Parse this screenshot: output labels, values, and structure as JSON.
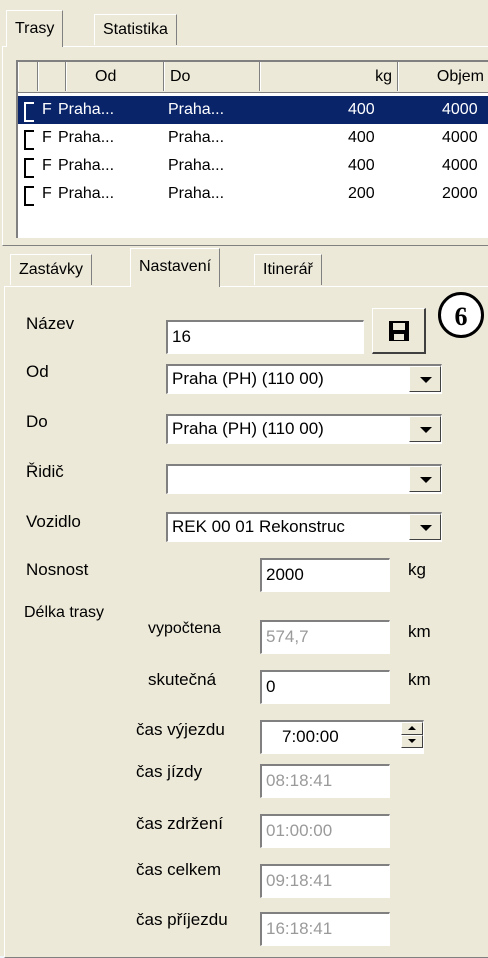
{
  "top_tabs": [
    "Trasy",
    "Statistika"
  ],
  "grid": {
    "columns": [
      "",
      "Od",
      "Do",
      "kg",
      "Objem"
    ],
    "rows": [
      {
        "flag": "F",
        "od": "Praha...",
        "do": "Praha...",
        "kg": "400",
        "objem": "4000",
        "selected": true
      },
      {
        "flag": "F",
        "od": "Praha...",
        "do": "Praha...",
        "kg": "400",
        "objem": "4000",
        "selected": false
      },
      {
        "flag": "F",
        "od": "Praha...",
        "do": "Praha...",
        "kg": "400",
        "objem": "4000",
        "selected": false
      },
      {
        "flag": "F",
        "od": "Praha...",
        "do": "Praha...",
        "kg": "200",
        "objem": "2000",
        "selected": false
      }
    ]
  },
  "sub_tabs": [
    "Zastávky",
    "Nastavení",
    "Itinerář"
  ],
  "form": {
    "nazev_label": "Název",
    "nazev_value": "16",
    "od_label": "Od",
    "od_value": "Praha  (PH) (110 00)",
    "do_label": "Do",
    "do_value": "Praha  (PH) (110 00)",
    "ridic_label": "Řidič",
    "ridic_value": "",
    "vozidlo_label": "Vozidlo",
    "vozidlo_value": "REK 00 01 Rekonstruc",
    "nosnost_label": "Nosnost",
    "nosnost_value": "2000",
    "nosnost_unit": "kg",
    "delka_label": "Délka trasy",
    "vypoctena_label": "vypočtena",
    "vypoctena_value": "574,7",
    "vypoctena_unit": "km",
    "skutecna_label": "skutečná",
    "skutecna_value": "0",
    "skutecna_unit": "km",
    "cas_vyjezdu_label": "čas výjezdu",
    "cas_vyjezdu_value": "7:00:00",
    "cas_jizdy_label": "čas jízdy",
    "cas_jizdy_value": "08:18:41",
    "cas_zdrzeni_label": "čas zdržení",
    "cas_zdrzeni_value": "01:00:00",
    "cas_celkem_label": "čas celkem",
    "cas_celkem_value": "09:18:41",
    "cas_prijezdu_label": "čas příjezdu",
    "cas_prijezdu_value": "16:18:41"
  },
  "callout_number": "6",
  "colors": {
    "selection": "#0a246a",
    "face": "#ece9d8"
  }
}
